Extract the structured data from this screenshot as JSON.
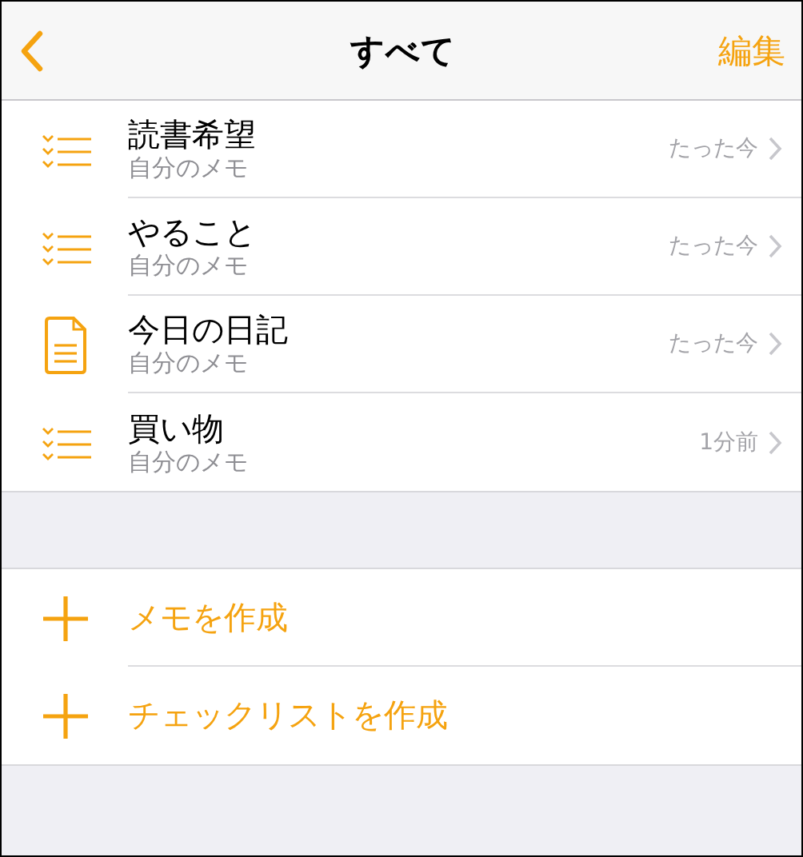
{
  "nav_bar": {
    "title": "すべて",
    "edit": "編集"
  },
  "notes": [
    {
      "kind": "checklist",
      "title": "読書希望",
      "folder": "自分のメモ",
      "time": "たった今"
    },
    {
      "kind": "checklist",
      "title": "やること",
      "folder": "自分のメモ",
      "time": "たった今"
    },
    {
      "kind": "note",
      "title": "今日の日記",
      "folder": "自分のメモ",
      "time": "たった今"
    },
    {
      "kind": "checklist",
      "title": "買い物",
      "folder": "自分のメモ",
      "time": "1分前"
    }
  ],
  "actions": [
    {
      "label": "メモを作成"
    },
    {
      "label": "チェックリストを作成"
    }
  ]
}
